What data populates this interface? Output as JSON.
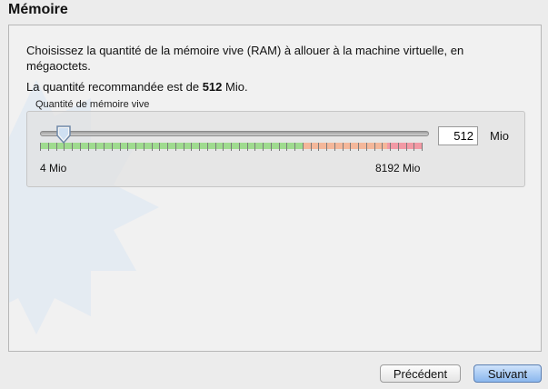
{
  "page": {
    "title": "Mémoire"
  },
  "description": "Choisissez la quantité de la mémoire vive (RAM) à allouer à la machine virtuelle, en mégaoctets.",
  "recommendation": {
    "prefix": "La quantité recommandée est de",
    "value": "512",
    "suffix": "Mio."
  },
  "memory": {
    "group_label": "Quantité de mémoire vive",
    "min_label": "4 Mio",
    "max_label": "8192 Mio",
    "min": 4,
    "max": 8192,
    "value": 512,
    "input_value": "512",
    "unit": "Mio",
    "zones": [
      {
        "to": 0.69,
        "color": "#9fdb8f"
      },
      {
        "to": 0.91,
        "color": "#f4b79a"
      },
      {
        "to": 1.0,
        "color": "#f29aa5"
      }
    ]
  },
  "buttons": {
    "previous": "Précédent",
    "next": "Suivant"
  }
}
